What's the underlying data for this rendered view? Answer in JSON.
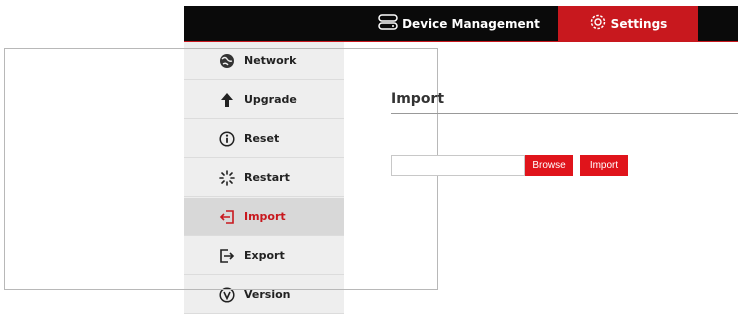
{
  "header": {
    "tabs": [
      {
        "label": "Device Management",
        "icon": "server-icon",
        "active": false
      },
      {
        "label": "Settings",
        "icon": "gear-icon",
        "active": true
      }
    ]
  },
  "sidebar": {
    "items": [
      {
        "label": "Network",
        "icon": "globe-icon",
        "active": false
      },
      {
        "label": "Upgrade",
        "icon": "arrow-up-icon",
        "active": false
      },
      {
        "label": "Reset",
        "icon": "info-icon",
        "active": false
      },
      {
        "label": "Restart",
        "icon": "spinner-icon",
        "active": false
      },
      {
        "label": "Import",
        "icon": "import-icon",
        "active": true
      },
      {
        "label": "Export",
        "icon": "export-icon",
        "active": false
      },
      {
        "label": "Version",
        "icon": "version-icon",
        "active": false
      }
    ]
  },
  "main": {
    "title": "Import",
    "file_input": {
      "value": "",
      "placeholder": ""
    },
    "browse_label": "Browse",
    "import_label": "Import"
  },
  "colors": {
    "accent": "#c8181e",
    "button": "#e0141b",
    "topbar": "#0a0a0a",
    "sidebar": "#eeeeee",
    "sidebar_active": "#d8d8d8"
  }
}
